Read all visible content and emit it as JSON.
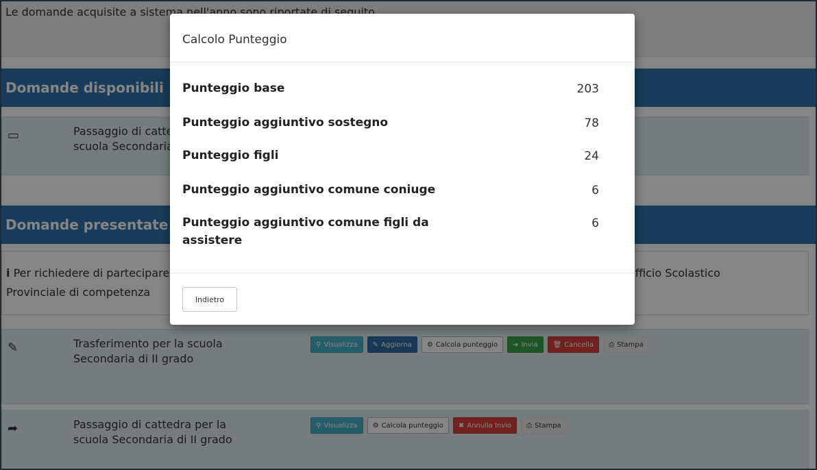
{
  "background": {
    "notice_text": "Le domande acquisite a sistema nell'anno sono riportate di seguito",
    "section_available": "Domande disponibili",
    "available_item": "Passaggio di cattedra per la scuola Secondaria di II grado",
    "section_submitted": "Domande presentate",
    "info_line1": "Per richiedere di partecipare alla mobilità rivolgersi all'",
    "info_line2": "Provinciale di competenza",
    "info_right": "Ufficio Scolastico",
    "rows": [
      {
        "text": "Trasferimento per la scuola Secondaria di II grado",
        "buttons": {
          "view": "Visualizza",
          "update": "Aggiorna",
          "calc": "Calcola punteggio",
          "send": "Invia",
          "delete": "Cancella",
          "print": "Stampa"
        }
      },
      {
        "text": "Passaggio di cattedra per la scuola Secondaria di II grado",
        "buttons": {
          "view": "Visualizza",
          "calc": "Calcola punteggio",
          "cancel_send": "Annulla Invio",
          "print": "Stampa"
        }
      }
    ]
  },
  "modal": {
    "title": "Calcolo Punteggio",
    "rows": [
      {
        "label": "Punteggio base",
        "value": "203"
      },
      {
        "label": "Punteggio aggiuntivo sostegno",
        "value": "78"
      },
      {
        "label": "Punteggio figli",
        "value": "24"
      },
      {
        "label": "Punteggio aggiuntivo comune coniuge",
        "value": "6"
      },
      {
        "label": "Punteggio aggiuntivo comune figli da assistere",
        "value": "6"
      }
    ],
    "back_label": "Indietro"
  }
}
